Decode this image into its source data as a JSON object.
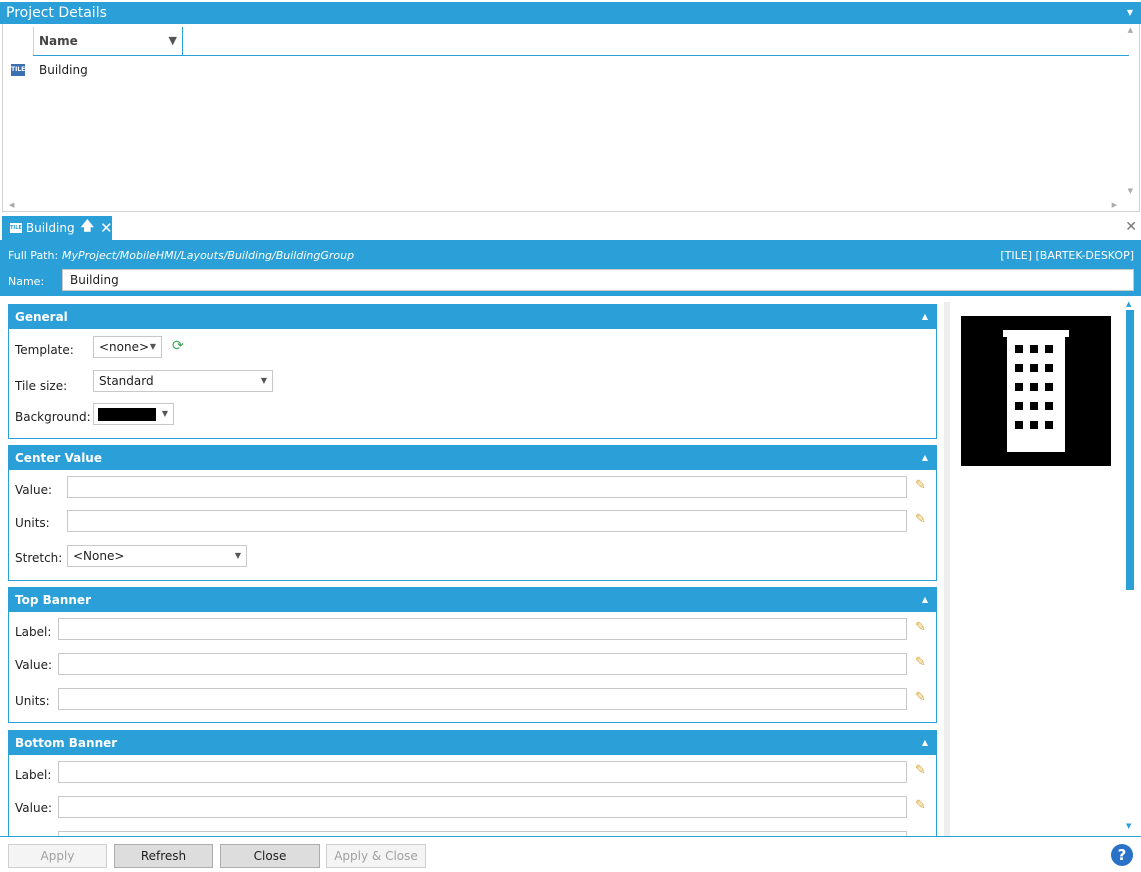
{
  "project_details": {
    "title": "Project Details",
    "column_name": "Name",
    "rows": [
      {
        "label": "Building",
        "icon": "tile-icon"
      }
    ]
  },
  "tab": {
    "label": "Building",
    "icon_text": "TILE"
  },
  "info": {
    "full_path_label": "Full Path:",
    "full_path_value": "MyProject/MobileHMI/Layouts/Building/BuildingGroup",
    "tile_info": "[TILE] [BARTEK-DESKOP]",
    "name_label": "Name:",
    "name_value": "Building"
  },
  "sections": {
    "general": {
      "title": "General",
      "template_label": "Template:",
      "template_value": "<none>",
      "tile_size_label": "Tile size:",
      "tile_size_value": "Standard",
      "background_label": "Background:",
      "background_color": "#000000"
    },
    "center_value": {
      "title": "Center Value",
      "value_label": "Value:",
      "units_label": "Units:",
      "stretch_label": "Stretch:",
      "stretch_value": "<None>"
    },
    "top_banner": {
      "title": "Top Banner",
      "label_label": "Label:",
      "value_label": "Value:",
      "units_label": "Units:"
    },
    "bottom_banner": {
      "title": "Bottom Banner",
      "label_label": "Label:",
      "value_label": "Value:"
    }
  },
  "buttons": {
    "apply": "Apply",
    "refresh": "Refresh",
    "close": "Close",
    "apply_close": "Apply & Close"
  },
  "colors": {
    "accent": "#2a9fd8",
    "help": "#2a72c8"
  },
  "help_glyph": "?"
}
